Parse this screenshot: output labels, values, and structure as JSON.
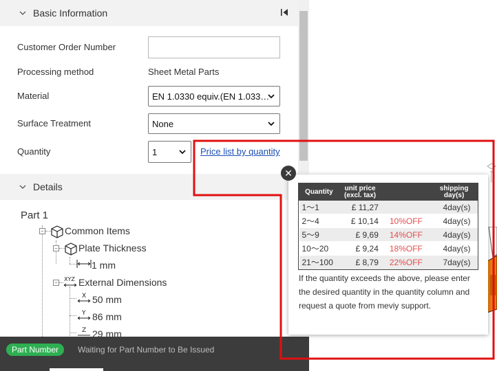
{
  "basic": {
    "title": "Basic Information",
    "fields": {
      "order_label": "Customer Order Number",
      "order_value": "",
      "method_label": "Processing method",
      "method_value": "Sheet Metal Parts",
      "material_label": "Material",
      "material_value": "EN 1.0330 equiv.(EN 1.033…",
      "surface_label": "Surface Treatment",
      "surface_value": "None",
      "quantity_label": "Quantity",
      "quantity_value": "1",
      "price_link": "Price list by quantity"
    }
  },
  "details": {
    "title": "Details",
    "tree": {
      "part": "Part 1",
      "common": "Common Items",
      "plate": "Plate Thickness",
      "plate_value": "1 mm",
      "external": "External Dimensions",
      "x": "50 mm",
      "y": "86 mm",
      "z": "29 mm",
      "x_axis": "X",
      "y_axis": "Y",
      "z_axis": "Z",
      "xyz": "XYZ"
    }
  },
  "status": {
    "badge": "Part Number",
    "message": "Waiting for Part Number to Be Issued"
  },
  "price_popup": {
    "headers": {
      "quantity": "Quantity",
      "unit_price": "unit price (excl. tax)",
      "discount": "",
      "shipping": "shipping day(s)"
    },
    "rows": [
      {
        "qty": "1～1",
        "price": "£ 11,27",
        "discount": "",
        "ship": "4day(s)"
      },
      {
        "qty": "2～4",
        "price": "£ 10,14",
        "discount": "10%OFF",
        "ship": "4day(s)"
      },
      {
        "qty": "5～9",
        "price": "£ 9,69",
        "discount": "14%OFF",
        "ship": "4day(s)"
      },
      {
        "qty": "10～20",
        "price": "£ 9,24",
        "discount": "18%OFF",
        "ship": "4day(s)"
      },
      {
        "qty": "21～100",
        "price": "£ 8,79",
        "discount": "22%OFF",
        "ship": "7day(s)"
      }
    ],
    "note": "If the quantity exceeds the above, please enter the desired quantity in the quantity column and request a quote from meviy support.",
    "close": "✕"
  },
  "colors": {
    "accent_red": "#e01010",
    "badge_green": "#2eaf52",
    "discount_red": "#e34d4d",
    "link_blue": "#1a4fb5"
  },
  "icons": {
    "chevron": "chevron-down-icon",
    "collapse": "collapse-panel-icon",
    "cube": "cube-icon",
    "dimension": "dimension-icon"
  }
}
